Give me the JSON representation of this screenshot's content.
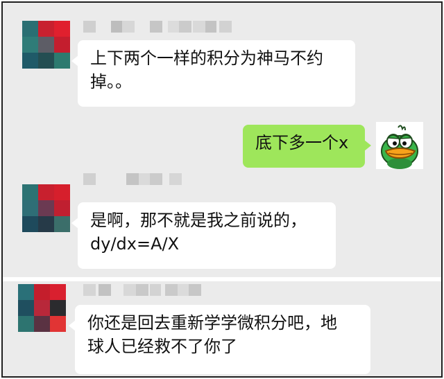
{
  "chat": {
    "messages": [
      {
        "sender": "other",
        "name_label": "",
        "lines": [
          "上下两个一样的积分为神马不约",
          "掉。。"
        ],
        "avatar_colors": [
          "#2a6f73",
          "#c8212f",
          "#e0202e",
          "#2f7c78",
          "#5d5d66",
          "#c41e2e",
          "#1f5a68",
          "#244e52",
          "#2d7a6f"
        ]
      },
      {
        "sender": "self",
        "lines": [
          "底下多一个x"
        ],
        "avatar_icon": "green-duck-icon"
      },
      {
        "sender": "other",
        "name_label": "",
        "lines": [
          "是啊，那不就是我之前说的，",
          "dy/dx=A/X"
        ],
        "avatar_colors": [
          "#2c7373",
          "#c8202e",
          "#d61f2c",
          "#2f6e76",
          "#6b3a52",
          "#c01f30",
          "#1e4a5c",
          "#263a48",
          "#3b6e6a"
        ]
      },
      {
        "sender": "other",
        "name_label": "",
        "lines": [
          "你还是回去重新学学微积分吧，地",
          "球人已经救不了你了"
        ],
        "avatar_colors": [
          "#2a7078",
          "#c41e2c",
          "#d9202f",
          "#1f4f5f",
          "#b8283a",
          "#2b2b2e",
          "#2d7470",
          "#5a3242",
          "#e13434"
        ]
      }
    ]
  },
  "colors": {
    "chat_background": "#ebebeb",
    "incoming_bubble": "#ffffff",
    "outgoing_bubble": "#9ee65b",
    "frame_border": "#1f1f1f"
  }
}
